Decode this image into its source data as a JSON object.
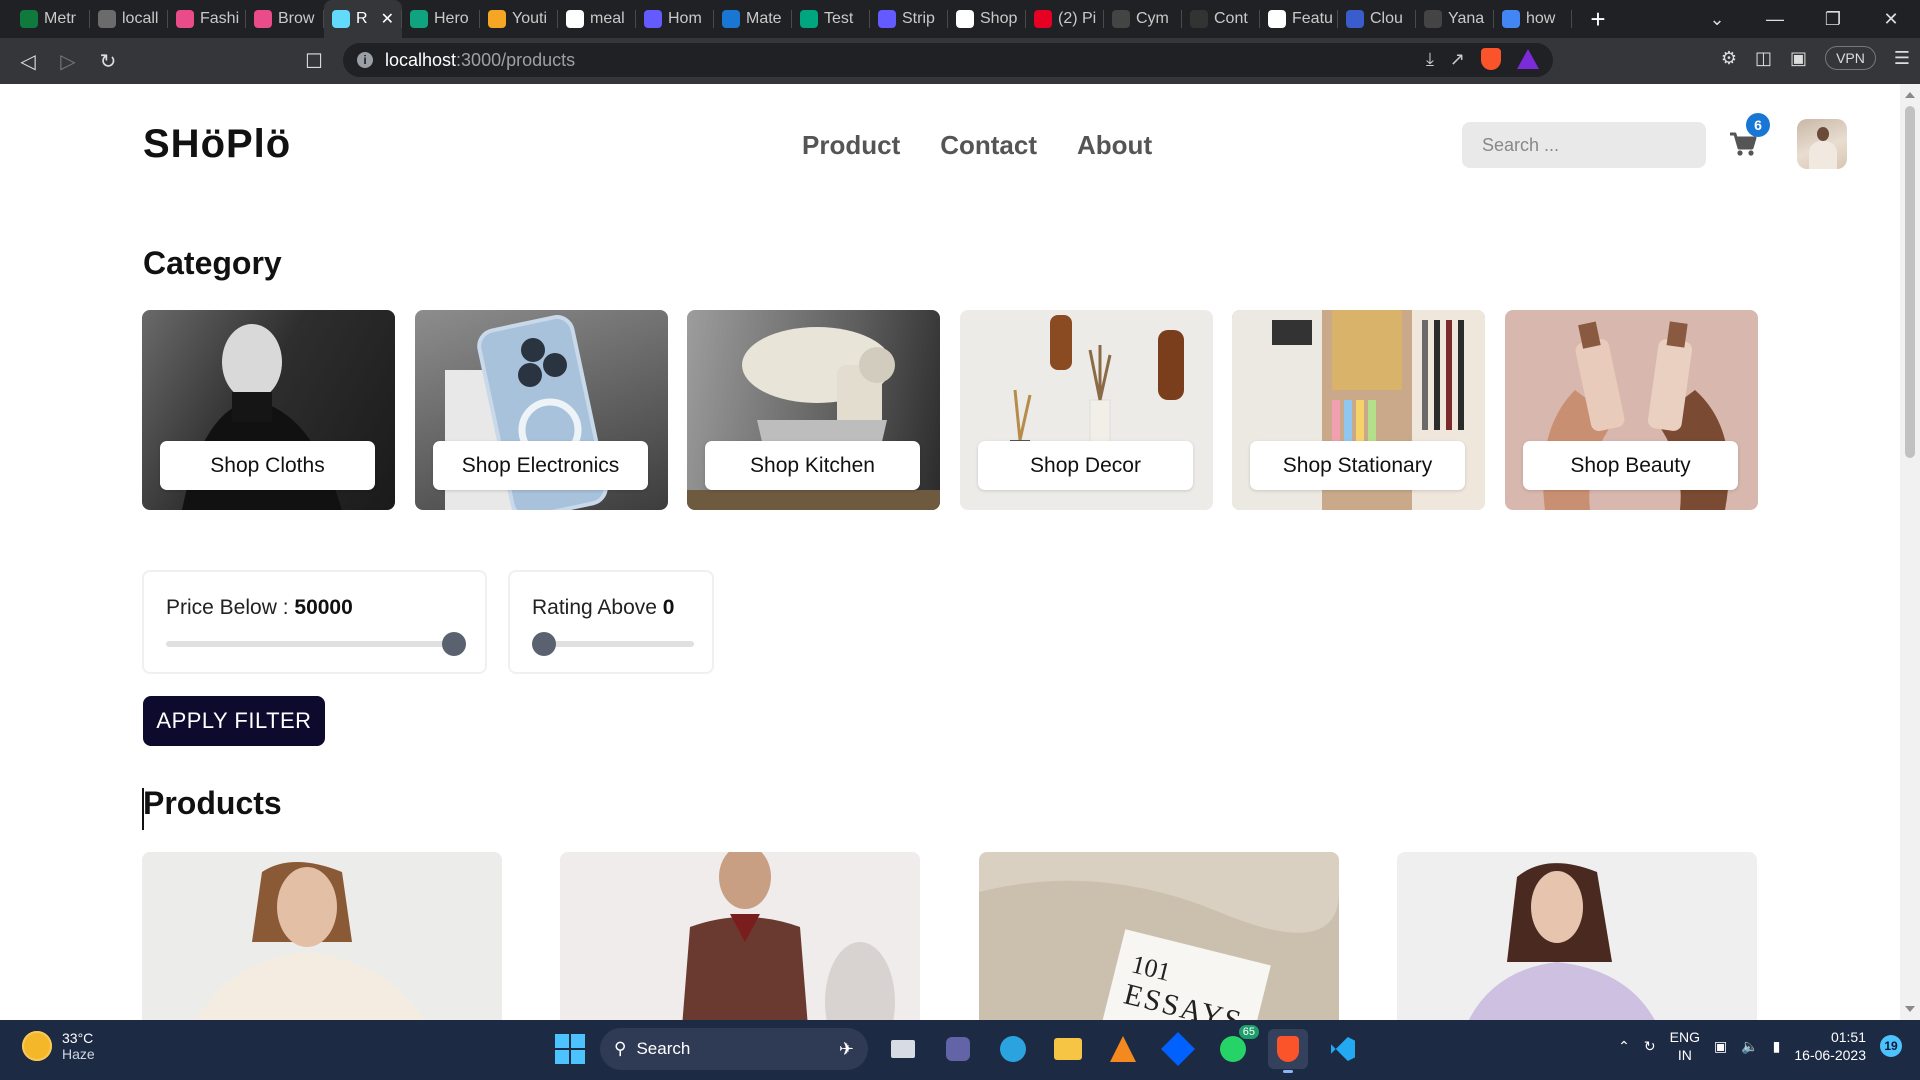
{
  "browser": {
    "tabs": [
      {
        "label": "Metr",
        "color": "#0f7a3e"
      },
      {
        "label": "locall",
        "color": "#6b6b6b"
      },
      {
        "label": "Fashi",
        "color": "#ea4c89"
      },
      {
        "label": "Brow",
        "color": "#ea4c89"
      },
      {
        "label": "R",
        "color": "#61dafb",
        "active": true
      },
      {
        "label": "Hero",
        "color": "#10a37f"
      },
      {
        "label": "Youti",
        "color": "#f5a623"
      },
      {
        "label": "meal",
        "color": "#ffffff"
      },
      {
        "label": "Hom",
        "color": "#635bff"
      },
      {
        "label": "Mate",
        "color": "#1976d2"
      },
      {
        "label": "Test",
        "color": "#00a67e"
      },
      {
        "label": "Strip",
        "color": "#635bff"
      },
      {
        "label": "Shop",
        "color": "#ffffff"
      },
      {
        "label": "(2) Pi",
        "color": "#e60023"
      },
      {
        "label": "Cym",
        "color": "#444444"
      },
      {
        "label": "Cont",
        "color": "#333333"
      },
      {
        "label": "Featu",
        "color": "#ffffff"
      },
      {
        "label": "Clou",
        "color": "#3b5ccc"
      },
      {
        "label": "Yana",
        "color": "#444444"
      },
      {
        "label": "how",
        "color": "#4285f4"
      }
    ],
    "url_host": "localhost",
    "url_path": ":3000/products",
    "vpn_label": "VPN"
  },
  "site": {
    "logo": "SHöPlö",
    "menu": [
      "Product",
      "Contact",
      "About"
    ],
    "search_placeholder": "Search ...",
    "cart_count": "6"
  },
  "category": {
    "title": "Category",
    "items": [
      {
        "label": "Shop Cloths",
        "icon": "turtleneck-man-photo"
      },
      {
        "label": "Shop Electronics",
        "icon": "smartphone-photo"
      },
      {
        "label": "Shop Kitchen",
        "icon": "stand-mixer-photo"
      },
      {
        "label": "Shop Decor",
        "icon": "wall-vases-photo"
      },
      {
        "label": "Shop Stationary",
        "icon": "stationery-photo"
      },
      {
        "label": "Shop Beauty",
        "icon": "serum-bottles-photo"
      }
    ]
  },
  "filters": {
    "price_label": "Price Below : ",
    "price_value": "50000",
    "price_level": 1.0,
    "rating_label": "Rating Above ",
    "rating_value": "0",
    "rating_level": 0.0,
    "apply_label": "APPLY FILTER"
  },
  "products": {
    "title": "Products",
    "items": [
      {
        "icon": "woman-cream-cardigan-photo"
      },
      {
        "icon": "man-knit-polo-photo"
      },
      {
        "icon": "book-101-essays-photo",
        "text_line1": "101",
        "text_line2": "ESSAYS"
      },
      {
        "icon": "woman-lilac-cardigan-photo"
      }
    ]
  },
  "taskbar": {
    "temp": "33°C",
    "weather": "Haze",
    "search_label": "Search",
    "whatsapp_badge": "65",
    "lang_1": "ENG",
    "lang_2": "IN",
    "time": "01:51",
    "date": "16-06-2023",
    "notifications": "19"
  }
}
